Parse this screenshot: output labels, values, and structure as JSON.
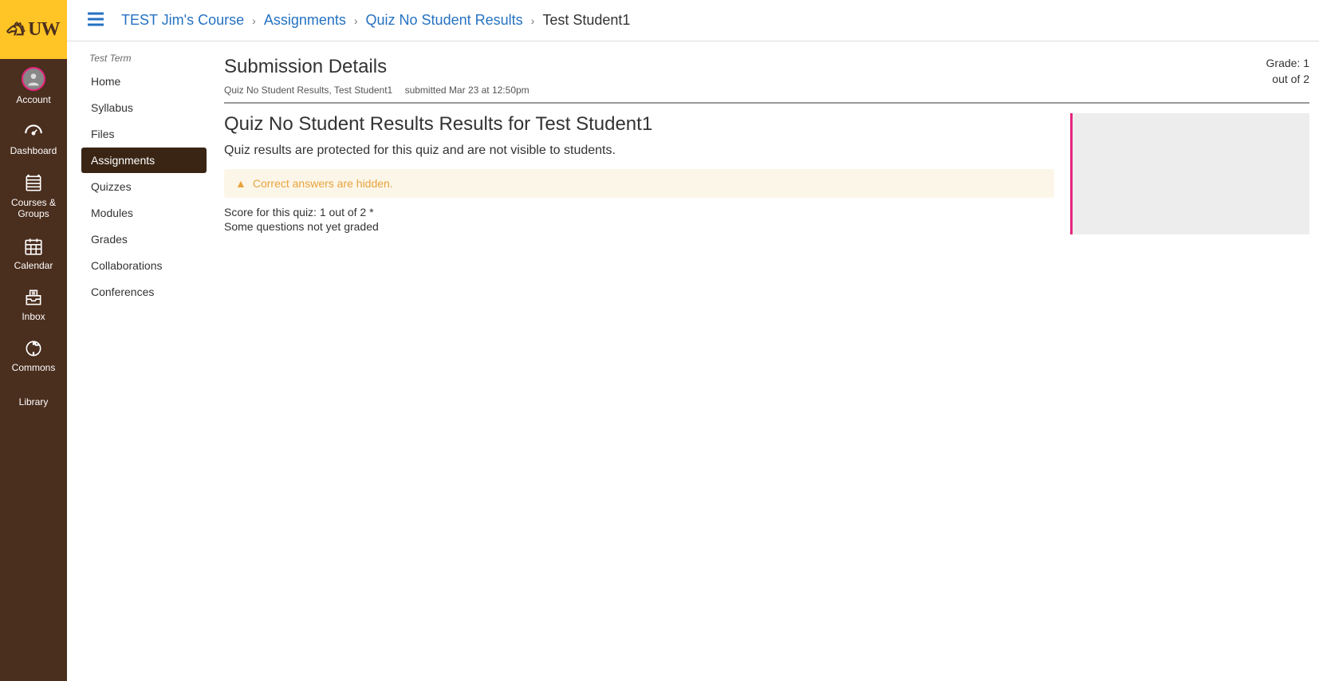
{
  "logo": {
    "text": "UW"
  },
  "global_nav": [
    {
      "id": "account",
      "label": "Account"
    },
    {
      "id": "dashboard",
      "label": "Dashboard"
    },
    {
      "id": "courses",
      "label": "Courses & Groups"
    },
    {
      "id": "calendar",
      "label": "Calendar"
    },
    {
      "id": "inbox",
      "label": "Inbox"
    },
    {
      "id": "commons",
      "label": "Commons"
    },
    {
      "id": "library",
      "label": "Library"
    }
  ],
  "breadcrumb": {
    "items": [
      {
        "label": "TEST Jim's Course",
        "link": true
      },
      {
        "label": "Assignments",
        "link": true
      },
      {
        "label": "Quiz No Student Results",
        "link": true
      },
      {
        "label": "Test Student1",
        "link": false
      }
    ]
  },
  "course_nav": {
    "term": "Test Term",
    "items": [
      {
        "label": "Home"
      },
      {
        "label": "Syllabus"
      },
      {
        "label": "Files"
      },
      {
        "label": "Assignments",
        "active": true
      },
      {
        "label": "Quizzes"
      },
      {
        "label": "Modules"
      },
      {
        "label": "Grades"
      },
      {
        "label": "Collaborations"
      },
      {
        "label": "Conferences"
      }
    ]
  },
  "page": {
    "title": "Submission Details",
    "sub_item": "Quiz No Student Results, Test Student1",
    "sub_submitted": "submitted Mar 23 at 12:50pm",
    "grade_label": "Grade: 1",
    "grade_outof": "out of 2",
    "results_title": "Quiz No Student Results Results for Test Student1",
    "results_note": "Quiz results are protected for this quiz and are not visible to students.",
    "alert_text": "Correct answers are hidden.",
    "score_line": "Score for this quiz: 1 out of 2 *",
    "grading_note": "Some questions not yet graded"
  }
}
